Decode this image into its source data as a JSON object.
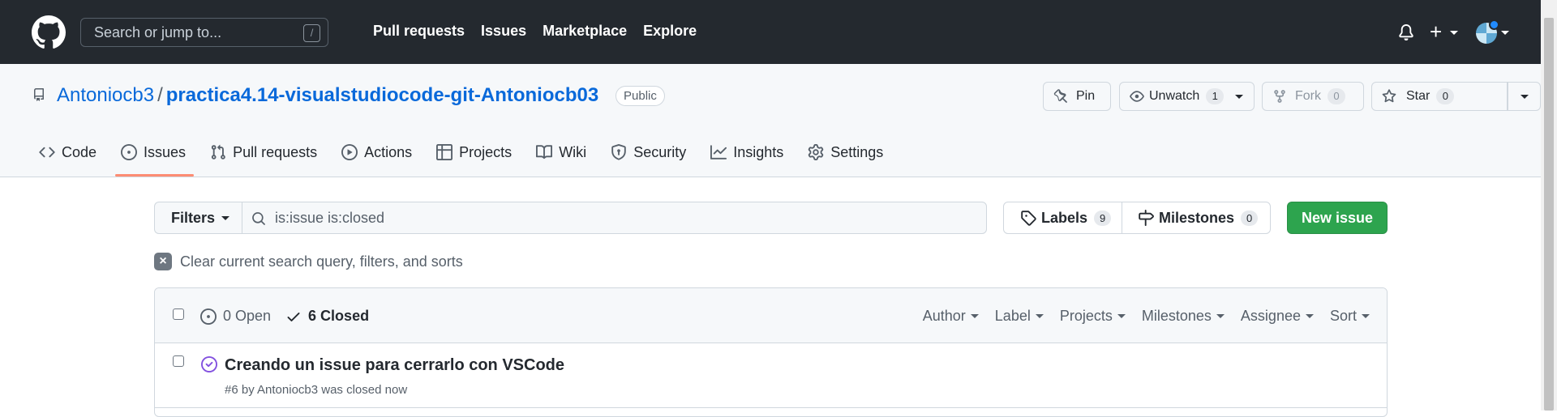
{
  "header": {
    "search_placeholder": "Search or jump to...",
    "search_shortcut": "/",
    "nav": [
      "Pull requests",
      "Issues",
      "Marketplace",
      "Explore"
    ]
  },
  "repo": {
    "owner": "Antoniocb3",
    "separator": "/",
    "name": "practica4.14-visualstudiocode-git-Antoniocb03",
    "visibility": "Public",
    "pin_label": "Pin",
    "unwatch_label": "Unwatch",
    "watch_count": "1",
    "fork_label": "Fork",
    "fork_count": "0",
    "star_label": "Star",
    "star_count": "0"
  },
  "tabs": [
    {
      "label": "Code",
      "icon": "code-icon"
    },
    {
      "label": "Issues",
      "icon": "issue-opened-icon",
      "selected": true
    },
    {
      "label": "Pull requests",
      "icon": "git-pull-request-icon"
    },
    {
      "label": "Actions",
      "icon": "play-icon"
    },
    {
      "label": "Projects",
      "icon": "table-icon"
    },
    {
      "label": "Wiki",
      "icon": "book-icon"
    },
    {
      "label": "Security",
      "icon": "shield-icon"
    },
    {
      "label": "Insights",
      "icon": "graph-icon"
    },
    {
      "label": "Settings",
      "icon": "gear-icon"
    }
  ],
  "filters": {
    "filters_label": "Filters",
    "query": "is:issue is:closed",
    "labels_label": "Labels",
    "labels_count": "9",
    "milestones_label": "Milestones",
    "milestones_count": "0",
    "new_issue_label": "New issue",
    "clear_label": "Clear current search query, filters, and sorts"
  },
  "issues_box": {
    "open_label": "0 Open",
    "closed_label": "6 Closed",
    "sorters": [
      "Author",
      "Label",
      "Projects",
      "Milestones",
      "Assignee",
      "Sort"
    ],
    "issues": [
      {
        "title": "Creando un issue para cerrarlo con VSCode",
        "meta": "#6 by Antoniocb3 was closed now"
      }
    ]
  },
  "colors": {
    "header_bg": "#24292f",
    "link_blue": "#0969da",
    "green": "#2da44e",
    "tab_underline": "#fd8c73",
    "closed_purple": "#8250df"
  }
}
